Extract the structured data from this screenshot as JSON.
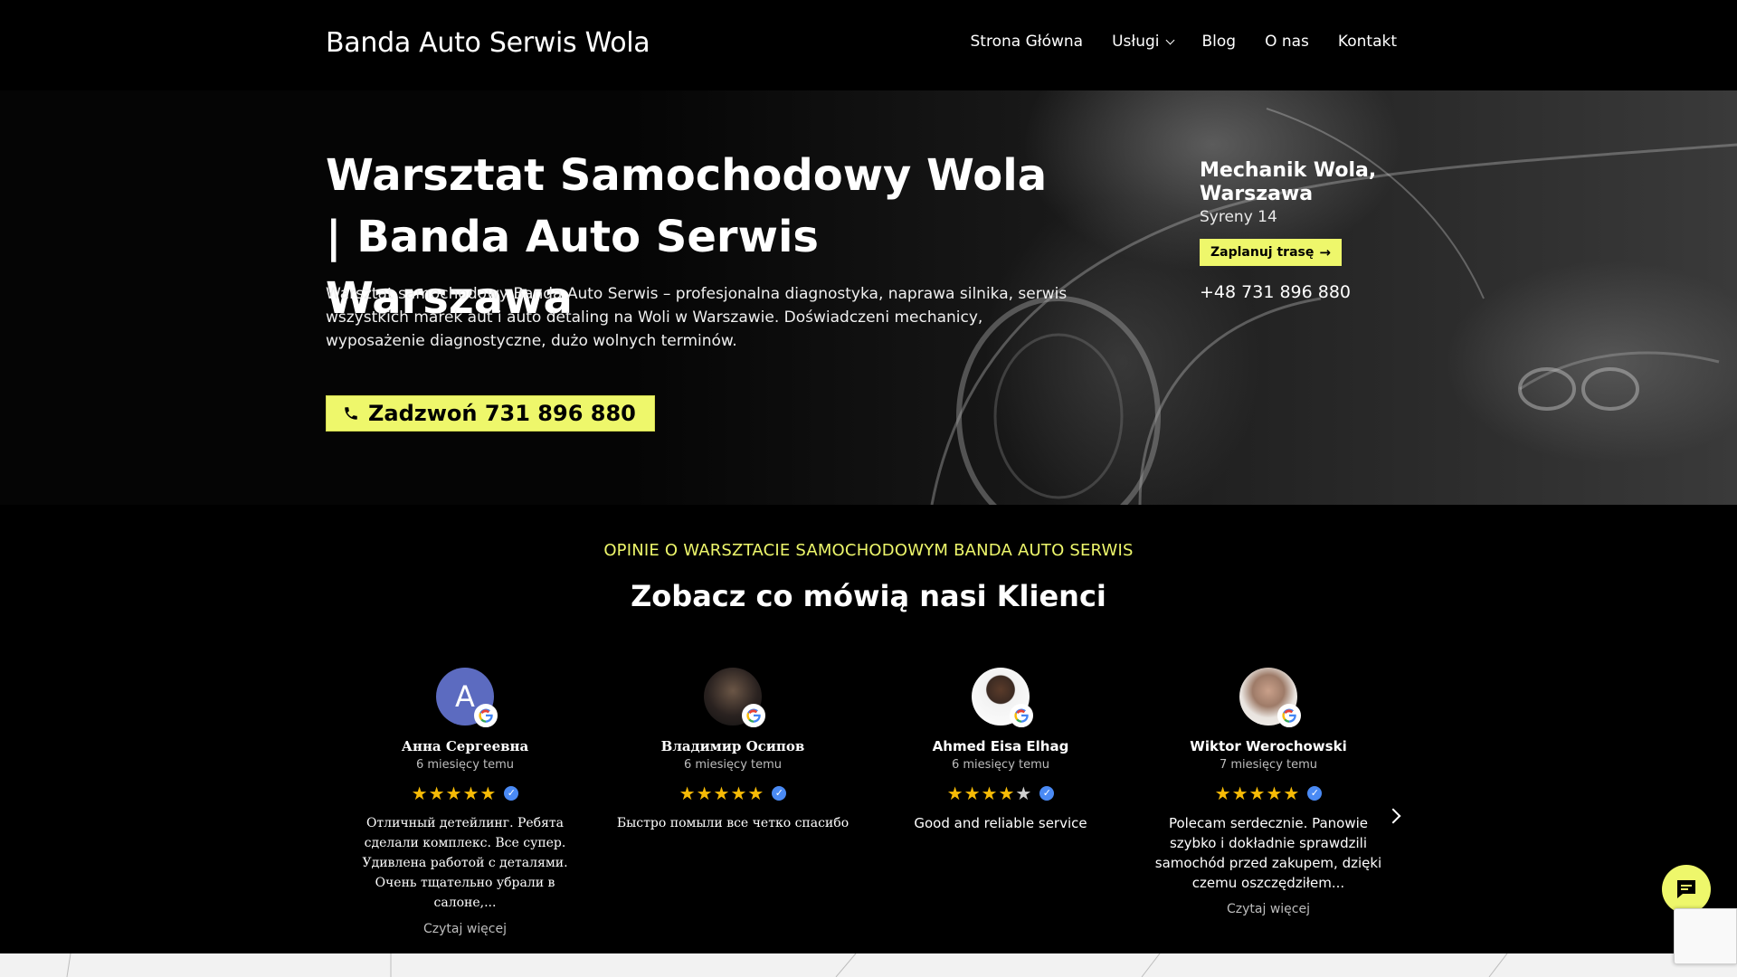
{
  "header": {
    "brand": "Banda Auto Serwis Wola",
    "nav": [
      {
        "label": "Strona Główna"
      },
      {
        "label": "Usługi",
        "has_dropdown": true
      },
      {
        "label": "Blog"
      },
      {
        "label": "O nas"
      },
      {
        "label": "Kontakt"
      }
    ]
  },
  "hero": {
    "title": "Warsztat Samochodowy Wola | Banda Auto Serwis Warszawa",
    "description": "Warsztat samochodowy Banda Auto Serwis – profesjonalna diagnostyka, naprawa silnika, serwis wszystkich marek aut i auto detaling na Woli w Warszawie. Doświadczeni mechanicy, wyposażenie diagnostyczne, dużo wolnych terminów.",
    "call_button": "Zadzwoń 731 896 880",
    "side": {
      "title": "Mechanik Wola, Warszawa",
      "address": "Syreny 14",
      "route_button": "Zaplanuj trasę",
      "phone": "+48 731 896 880"
    }
  },
  "reviews": {
    "kicker": "OPINIE O WARSZTACIE SAMOCHODOWYM BANDA AUTO SERWIS",
    "title": "Zobacz co mówią nasi Klienci",
    "items": [
      {
        "name": "Анна Сергеевна",
        "time": "6 miesięcy temu",
        "rating": 5,
        "text": "Отличный детейлинг. Ребята сделали комплекс. Все супер. Удивлена работой с деталями. Очень тщательно убрали в салоне,...",
        "more": "Czytaj więcej",
        "avatar_letter": "A"
      },
      {
        "name": "Владимир Осипов",
        "time": "6 miesięcy temu",
        "rating": 5,
        "text": "Быстро помыли все четко спасибо",
        "more": ""
      },
      {
        "name": "Ahmed Eisa Elhag",
        "time": "6 miesięcy temu",
        "rating": 4,
        "text": "Good and reliable service",
        "more": ""
      },
      {
        "name": "Wiktor Werochowski",
        "time": "7 miesięcy temu",
        "rating": 5,
        "text": "Polecam serdecznie. Panowie szybko i dokładnie sprawdzili samochód przed zakupem, dzięki czemu oszczędziłem...",
        "more": "Czytaj więcej"
      }
    ]
  },
  "colors": {
    "accent": "#eef76b",
    "star": "#f6bb06",
    "verified": "#4a8af4"
  }
}
